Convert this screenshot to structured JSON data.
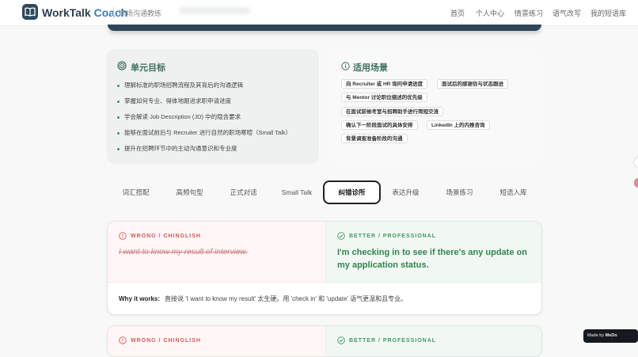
{
  "header": {
    "brand_main": "WorkTalk",
    "brand_accent": "Coach",
    "subtitle": "职场沟通教练",
    "nav": [
      "首页",
      "个人中心",
      "情景练习",
      "语气改写",
      "我的短语库"
    ]
  },
  "goals": {
    "title": "单元目标",
    "items": [
      "理解标准的职场招聘流程及其背后的沟通逻辑",
      "掌握如何专业、得体地跟进求职申请进度",
      "学会解读 Job Description (JD) 中的隐含要求",
      "能够在面试前后与 Recruiter 进行自然的职场寒暄（Small Talk）",
      "提升在招聘环节中的主动沟通意识和专业度"
    ]
  },
  "scenes": {
    "title": "适用场景",
    "chips": [
      "向 Recruiter 或 HR 询问申请进度",
      "面试后的感谢信与状态跟进",
      "与 Mentor 讨论职位描述的优先级",
      "在面试前候考室与招聘助手进行简短交流",
      "确认下一阶段面试的具体安排",
      "LinkedIn 上的内推咨询",
      "背景调查准备阶段的沟通"
    ]
  },
  "tabs": [
    "词汇搭配",
    "高频句型",
    "正式对话",
    "Small Talk",
    "纠错诊所",
    "表达升级",
    "场景练习",
    "短语入库"
  ],
  "active_tab": "纠错诊所",
  "diagnostics": [
    {
      "wrong_label": "WRONG / CHINGLISH",
      "wrong_text": "I want to know my result of interview.",
      "better_label": "BETTER / PROFESSIONAL",
      "better_text": "I'm checking in to see if there's any update on my application status.",
      "why_label": "Why it works:",
      "why_text": "直接说 'I want to know my result' 太生硬。用 'check in' 和 'update' 语气更温和且专业。"
    },
    {
      "wrong_label": "WRONG / CHINGLISH",
      "better_label": "BETTER / PROFESSIONAL"
    }
  ],
  "badge": {
    "text": "Made by",
    "brand": "MeDo"
  },
  "colors": {
    "primary": "#2d4658",
    "goal_accent": "#3e6f5d",
    "wrong": "#d25a5a",
    "better": "#3e9a62"
  }
}
